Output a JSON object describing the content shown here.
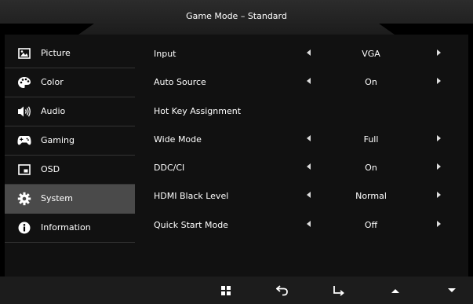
{
  "header": {
    "title": "Game Mode – Standard"
  },
  "sidebar": {
    "items": [
      {
        "label": "Picture",
        "icon": "picture-icon"
      },
      {
        "label": "Color",
        "icon": "palette-icon"
      },
      {
        "label": "Audio",
        "icon": "speaker-icon"
      },
      {
        "label": "Gaming",
        "icon": "gamepad-icon"
      },
      {
        "label": "OSD",
        "icon": "osd-icon"
      },
      {
        "label": "System",
        "icon": "gear-icon",
        "selected": true
      },
      {
        "label": "Information",
        "icon": "info-icon"
      }
    ]
  },
  "settings": {
    "rows": [
      {
        "label": "Input",
        "value": "VGA"
      },
      {
        "label": "Auto Source",
        "value": "On"
      },
      {
        "label": "Hot Key Assignment",
        "value": ""
      },
      {
        "label": "Wide Mode",
        "value": "Full"
      },
      {
        "label": "DDC/CI",
        "value": "On"
      },
      {
        "label": "HDMI Black Level",
        "value": "Normal"
      },
      {
        "label": "Quick Start Mode",
        "value": "Off"
      }
    ]
  },
  "footer": {
    "buttons": [
      "menu-grid-icon",
      "back-icon",
      "enter-icon",
      "up-arrow-icon",
      "down-arrow-icon"
    ]
  },
  "colors": {
    "background": "#000000",
    "panel": "#111111",
    "selected": "#4a4a4a",
    "header": "#2c2c2c"
  }
}
